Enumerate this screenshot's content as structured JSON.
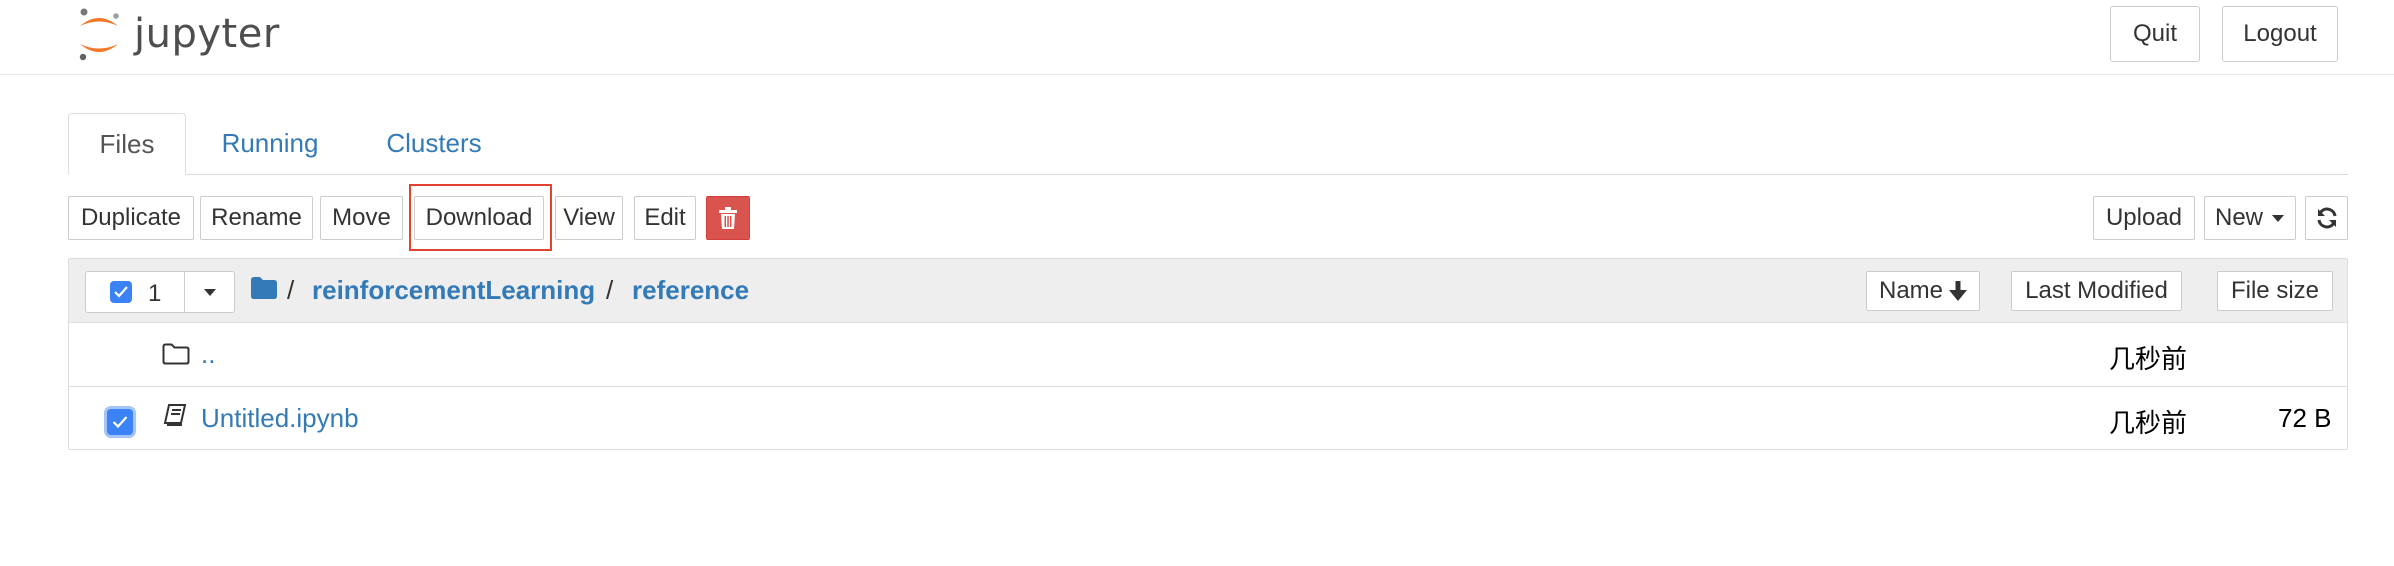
{
  "header": {
    "brand": "jupyter",
    "quit_label": "Quit",
    "logout_label": "Logout"
  },
  "tabs": [
    {
      "label": "Files",
      "active": true
    },
    {
      "label": "Running",
      "active": false
    },
    {
      "label": "Clusters",
      "active": false
    }
  ],
  "toolbar": {
    "duplicate": "Duplicate",
    "rename": "Rename",
    "move": "Move",
    "download": "Download",
    "view": "View",
    "edit": "Edit",
    "upload": "Upload",
    "new": "New"
  },
  "file_list": {
    "selected_count": "1",
    "breadcrumb": [
      "reinforcementLearning",
      "reference"
    ],
    "breadcrumb_sep": "/",
    "columns": {
      "name": "Name",
      "last_modified": "Last Modified",
      "file_size": "File size"
    },
    "rows": [
      {
        "name": "..",
        "modified": "几秒前",
        "size": "",
        "checked": false,
        "icon": "folder-icon"
      },
      {
        "name": "Untitled.ipynb",
        "modified": "几秒前",
        "size": "72 B",
        "checked": true,
        "icon": "notebook-icon"
      }
    ]
  },
  "colors": {
    "link": "#337ab7",
    "danger": "#d9534f",
    "highlight": "#e0432f",
    "checkbox": "#3b82f6"
  }
}
